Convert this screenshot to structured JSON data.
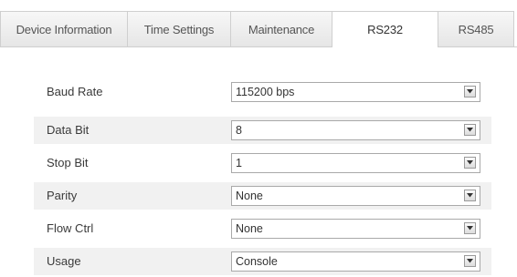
{
  "tabs": [
    {
      "label": "Device Information",
      "active": false
    },
    {
      "label": "Time Settings",
      "active": false
    },
    {
      "label": "Maintenance",
      "active": false
    },
    {
      "label": "RS232",
      "active": true
    },
    {
      "label": "RS485",
      "active": false
    }
  ],
  "settings": [
    {
      "label": "Baud Rate",
      "value": "115200 bps",
      "icon": "chevron-down-icon"
    },
    {
      "label": "Data Bit",
      "value": "8",
      "icon": "chevron-down-icon"
    },
    {
      "label": "Stop Bit",
      "value": "1",
      "icon": "chevron-down-icon"
    },
    {
      "label": "Parity",
      "value": "None",
      "icon": "chevron-down-icon"
    },
    {
      "label": "Flow Ctrl",
      "value": "None",
      "icon": "chevron-down-icon"
    },
    {
      "label": "Usage",
      "value": "Console",
      "icon": "chevron-down-icon"
    }
  ],
  "colors": {
    "row_shade": "#f1f1f1",
    "tab_border": "#cfcfcf",
    "active_tab_bg": "#ffffff"
  }
}
